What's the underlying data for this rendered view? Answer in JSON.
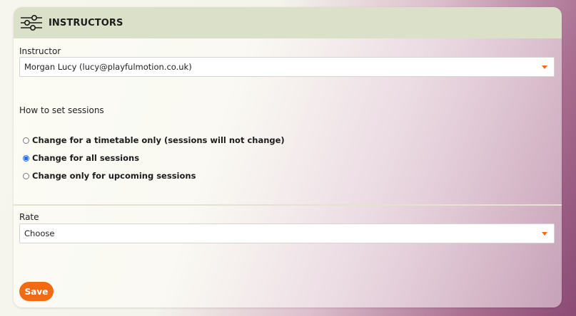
{
  "header": {
    "title": "INSTRUCTORS",
    "icon": "sliders-icon"
  },
  "instructor": {
    "label": "Instructor",
    "selected": "Morgan Lucy (lucy@playfulmotion.co.uk)"
  },
  "sessions": {
    "label": "How to set sessions",
    "options": [
      {
        "label": "Change for a timetable only (sessions will not change)",
        "checked": false
      },
      {
        "label": "Change for all sessions",
        "checked": true
      },
      {
        "label": "Change only for upcoming sessions",
        "checked": false
      }
    ]
  },
  "rate": {
    "label": "Rate",
    "selected": "Choose"
  },
  "actions": {
    "save_label": "Save"
  },
  "colors": {
    "accent": "#f26b13",
    "header_bg": "#dbe0c8",
    "radio_checked": "#2a6fd6"
  }
}
